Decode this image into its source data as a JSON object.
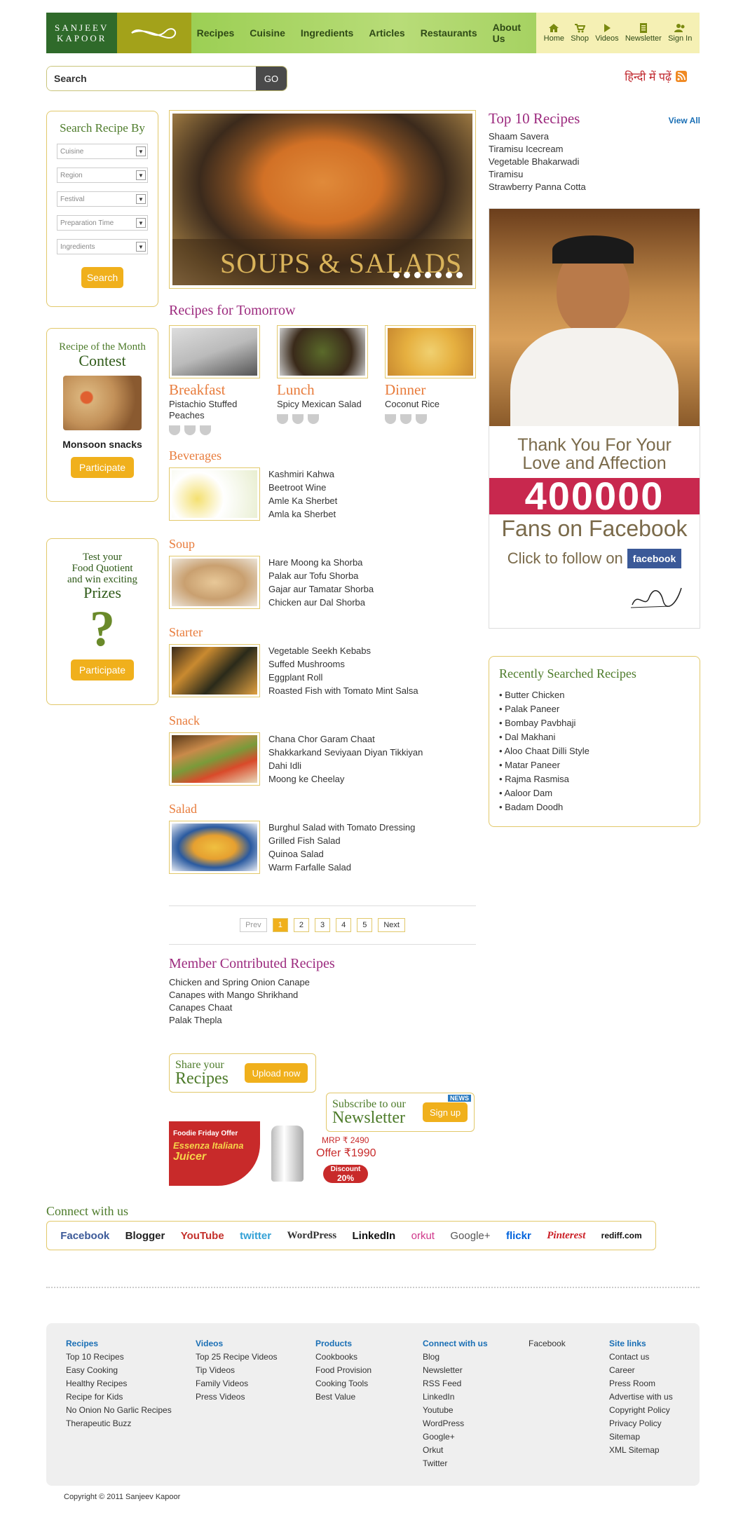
{
  "header": {
    "logo_line1": "SANJEEV",
    "logo_line2": "KAPOOR",
    "nav": [
      "Recipes",
      "Cuisine",
      "Ingredients",
      "Articles",
      "Restaurants",
      "About Us"
    ],
    "util": [
      {
        "label": "Home",
        "icon": "home-icon"
      },
      {
        "label": "Shop",
        "icon": "cart-icon"
      },
      {
        "label": "Videos",
        "icon": "play-icon"
      },
      {
        "label": "Newsletter",
        "icon": "newsletter-icon"
      },
      {
        "label": "Sign In",
        "icon": "user-icon"
      }
    ]
  },
  "search": {
    "placeholder": "Search",
    "button": "GO"
  },
  "hindi_link": "हिन्दी में पढ़ें",
  "search_by": {
    "title": "Search Recipe By",
    "fields": [
      "Cuisine",
      "Region",
      "Festival",
      "Preparation Time",
      "Ingredients"
    ],
    "button": "Search"
  },
  "contest": {
    "line1": "Recipe of the Month",
    "line2": "Contest",
    "name": "Monsoon snacks",
    "button": "Participate"
  },
  "quotient": {
    "line1": "Test your",
    "line2": "Food Quotient",
    "line3": "and win exciting",
    "line4": "Prizes",
    "button": "Participate"
  },
  "hero": {
    "caption": "SOUPS & SALADS",
    "slides": 7
  },
  "tomorrow": {
    "title": "Recipes for Tomorrow",
    "meals": [
      {
        "meal": "Breakfast",
        "dish": "Pistachio Stuffed Peaches"
      },
      {
        "meal": "Lunch",
        "dish": "Spicy Mexican Salad"
      },
      {
        "meal": "Dinner",
        "dish": "Coconut Rice"
      }
    ]
  },
  "categories": [
    {
      "name": "Beverages",
      "items": [
        "Kashmiri Kahwa",
        "Beetroot Wine",
        "Amle Ka Sherbet",
        "Amla ka Sherbet"
      ]
    },
    {
      "name": "Soup",
      "items": [
        "Hare Moong ka Shorba",
        "Palak aur Tofu Shorba",
        "Gajar aur Tamatar Shorba",
        "Chicken aur Dal Shorba"
      ]
    },
    {
      "name": "Starter",
      "items": [
        "Vegetable Seekh Kebabs",
        "Suffed Mushrooms",
        "Eggplant Roll",
        "Roasted Fish with Tomato Mint Salsa"
      ]
    },
    {
      "name": "Snack",
      "items": [
        "Chana Chor Garam Chaat",
        "Shakkarkand Seviyaan Diyan Tikkiyan",
        "Dahi Idli",
        "Moong ke Cheelay"
      ]
    },
    {
      "name": "Salad",
      "items": [
        "Burghul Salad with Tomato Dressing",
        "Grilled Fish Salad",
        "Quinoa Salad",
        "Warm Farfalle Salad"
      ]
    }
  ],
  "pager": {
    "prev": "Prev",
    "pages": [
      "1",
      "2",
      "3",
      "4",
      "5"
    ],
    "next": "Next"
  },
  "member": {
    "title": "Member Contributed Recipes",
    "items": [
      "Chicken and Spring Onion Canape",
      "Canapes with Mango Shrikhand",
      "Canapes Chaat",
      "Palak Thepla"
    ]
  },
  "promo": {
    "share_t1": "Share your",
    "share_t2": "Recipes",
    "share_btn": "Upload now",
    "sub_t1": "Subscribe to our",
    "sub_t2": "Newsletter",
    "sub_btn": "Sign up",
    "sub_badge": "NEWS"
  },
  "offer": {
    "tag": "Foodie Friday Offer",
    "product1": "Essenza Italiana",
    "product2": "Juicer",
    "mrp": "MRP ₹ 2490",
    "price": "Offer ₹1990",
    "discount1": "Discount",
    "discount2": "20%"
  },
  "top10": {
    "title": "Top 10 Recipes",
    "view_all": "View All",
    "items": [
      "Shaam Savera",
      "Tiramisu Icecream",
      "Vegetable Bhakarwadi",
      "Tiramisu",
      "Strawberry Panna Cotta"
    ]
  },
  "fb": {
    "line1": "Thank You For Your",
    "line2": "Love and Affection",
    "count": "400000",
    "line3": "Fans on Facebook",
    "follow": "Click to follow on",
    "fb": "facebook"
  },
  "recent": {
    "title": "Recently Searched Recipes",
    "items": [
      "Butter Chicken",
      "Palak Paneer",
      "Bombay Pavbhaji",
      "Dal Makhani",
      "Aloo Chaat Dilli Style",
      "Matar Paneer",
      "Rajma Rasmisa",
      "Aaloor Dam",
      "Badam Doodh"
    ]
  },
  "connect": {
    "title": "Connect with us",
    "links": [
      {
        "label": "Facebook",
        "color": "#3b5998"
      },
      {
        "label": "Blogger",
        "color": "#222222"
      },
      {
        "label": "YouTube",
        "color": "#c4302b"
      },
      {
        "label": "twitter",
        "color": "#33a1d6"
      },
      {
        "label": "WordPress",
        "color": "#333333"
      },
      {
        "label": "LinkedIn",
        "color": "#111111"
      },
      {
        "label": "orkut",
        "color": "#d0378a"
      },
      {
        "label": "Google+",
        "color": "#555555"
      },
      {
        "label": "flickr",
        "color": "#0063dc"
      },
      {
        "label": "Pinterest",
        "color": "#cb2027"
      },
      {
        "label": "rediff.com",
        "color": "#cc0000"
      }
    ]
  },
  "footer": {
    "cols": [
      {
        "head": "Recipes",
        "items": [
          "Top 10 Recipes",
          "Easy Cooking",
          "Healthy Recipes",
          "Recipe for Kids",
          "No Onion No Garlic Recipes",
          "Therapeutic Buzz"
        ]
      },
      {
        "head": "Videos",
        "items": [
          "Top 25 Recipe Videos",
          "Tip Videos",
          "Family Videos",
          "Press Videos"
        ]
      },
      {
        "head": "Products",
        "items": [
          "Cookbooks",
          "Food Provision",
          "Cooking Tools",
          "Best Value"
        ]
      },
      {
        "head": "Connect with us",
        "items": [
          "Blog",
          "Newsletter",
          "RSS Feed",
          "LinkedIn",
          "Youtube",
          "WordPress",
          "Google+",
          "Orkut",
          "Twitter"
        ]
      },
      {
        "head": "",
        "items": [
          "Facebook"
        ]
      },
      {
        "head": "Site links",
        "items": [
          "Contact us",
          "Career",
          "Press Room",
          "Advertise with us",
          "Copyright Policy",
          "Privacy Policy",
          "Sitemap",
          "XML Sitemap"
        ]
      }
    ],
    "copyright": "Copyright © 2011 Sanjeev Kapoor"
  }
}
